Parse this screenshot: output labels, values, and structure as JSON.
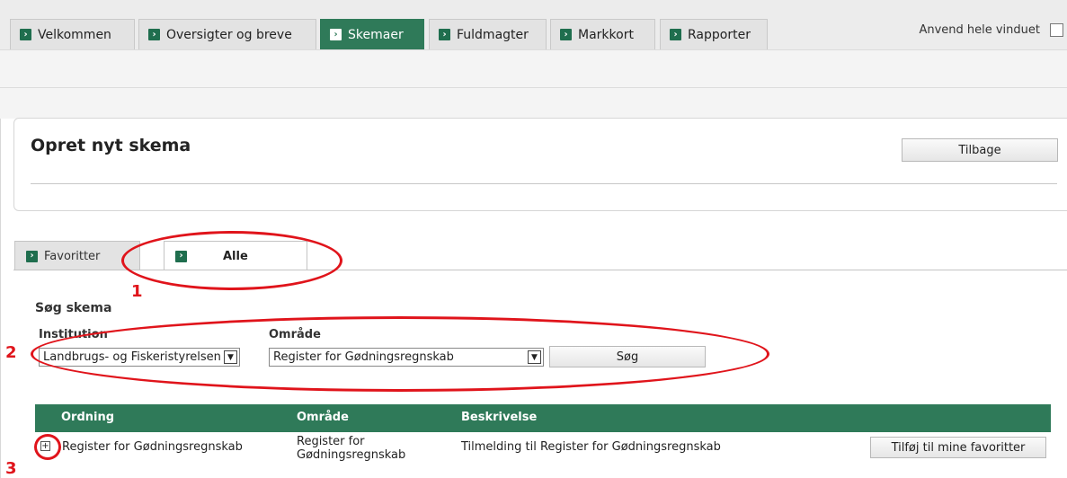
{
  "top_tabs": [
    {
      "label": "Velkommen"
    },
    {
      "label": "Oversigter og breve"
    },
    {
      "label": "Skemaer"
    },
    {
      "label": "Fuldmagter"
    },
    {
      "label": "Markkort"
    },
    {
      "label": "Rapporter"
    }
  ],
  "active_tab": "Skemaer",
  "full_window_label": "Anvend hele vinduet",
  "page_title": "Opret nyt skema",
  "back_button": "Tilbage",
  "sub_tabs": [
    {
      "label": "Favoritter"
    },
    {
      "label": "Alle"
    }
  ],
  "search": {
    "title": "Søg skema",
    "institution_label": "Institution",
    "institution_value": "Landbrugs- og Fiskeristyrelsen",
    "area_label": "Område",
    "area_value": "Register for Gødningsregnskab",
    "button": "Søg"
  },
  "table": {
    "headers": [
      "Ordning",
      "Område",
      "Beskrivelse"
    ],
    "rows": [
      {
        "ordning": "Register for Gødningsregnskab",
        "omraade_line1": "Register for",
        "omraade_line2": "Gødningsregnskab",
        "beskrivelse": "Tilmelding til Register for Gødningsregnskab",
        "action": "Tilføj til mine favoritter"
      }
    ]
  },
  "annotations": [
    "1",
    "2",
    "3"
  ],
  "colors": {
    "accent_green": "#2f7a59",
    "annotation_red": "#e0141b"
  }
}
